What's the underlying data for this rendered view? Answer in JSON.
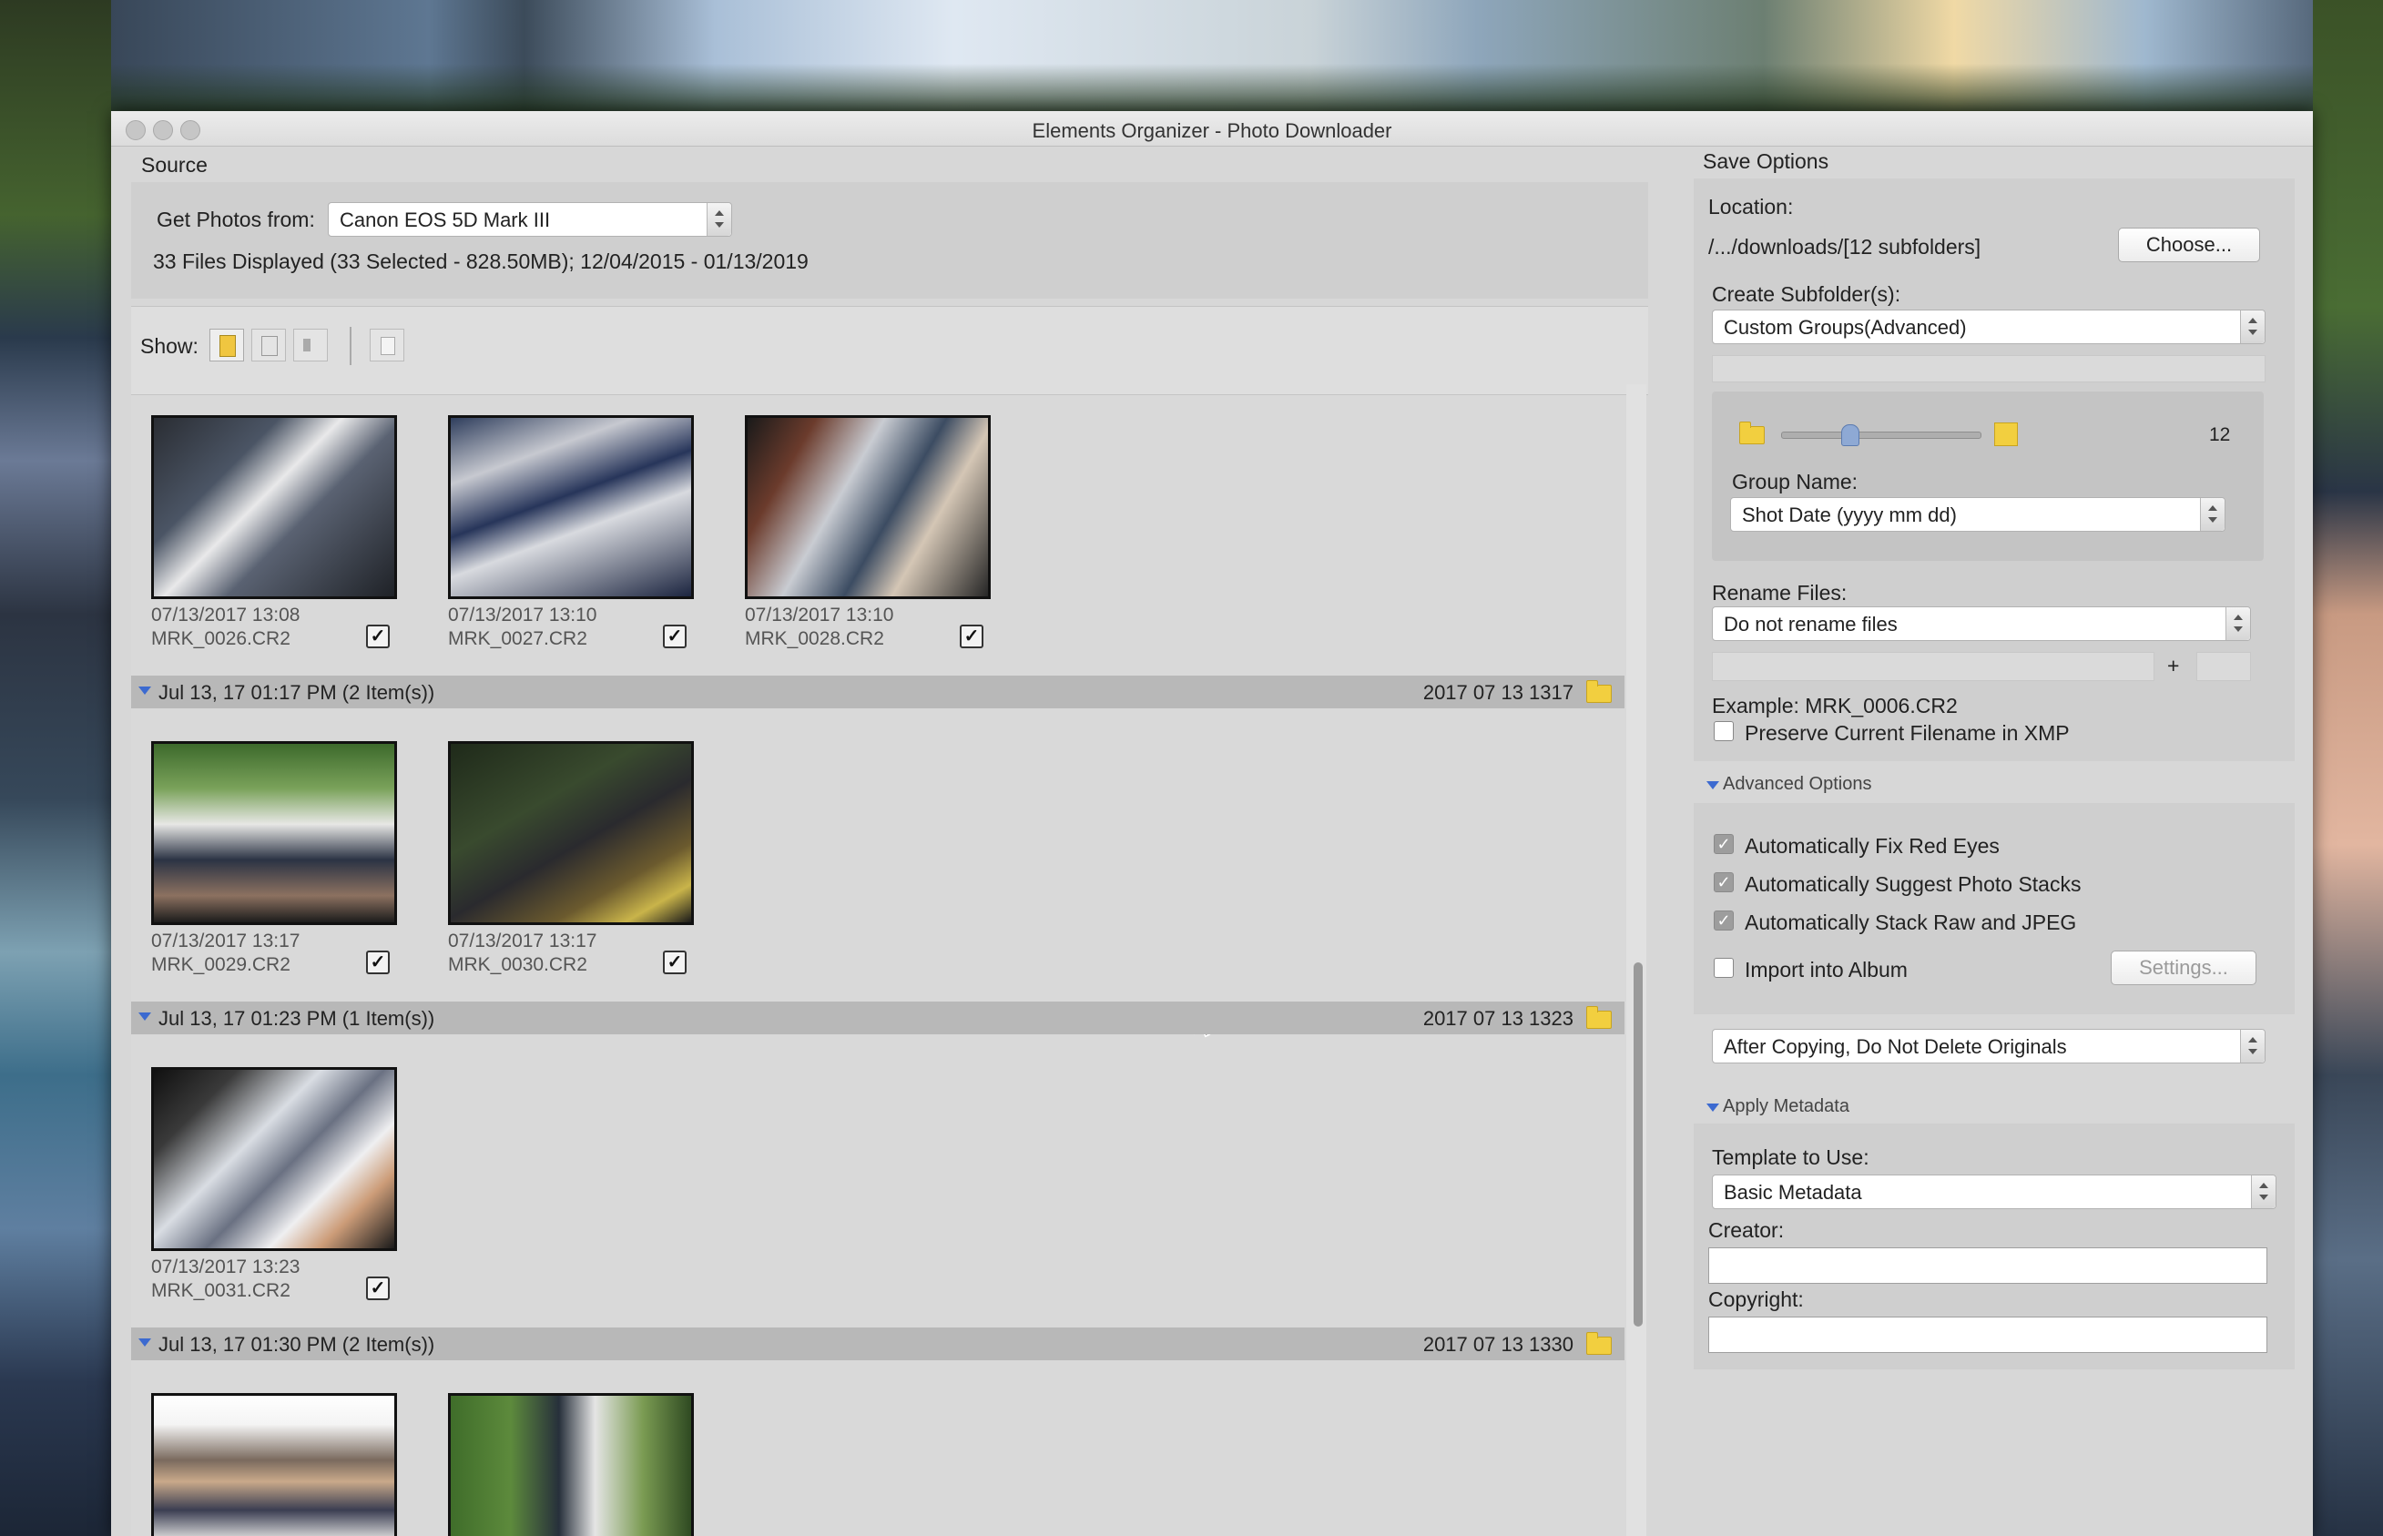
{
  "window": {
    "title": "Elements Organizer - Photo Downloader"
  },
  "source": {
    "section_title": "Source",
    "get_photos_label": "Get Photos from:",
    "device_value": "Canon EOS 5D Mark III",
    "files_summary": "33 Files Displayed (33 Selected - 828.50MB); 12/04/2015 - 01/13/2019"
  },
  "show": {
    "label": "Show:"
  },
  "groups": [
    {
      "label": "",
      "folder": "",
      "items": [
        {
          "date": "07/13/2017 13:08",
          "file": "MRK_0026.CR2",
          "checked": true
        },
        {
          "date": "07/13/2017 13:10",
          "file": "MRK_0027.CR2",
          "checked": true
        },
        {
          "date": "07/13/2017 13:10",
          "file": "MRK_0028.CR2",
          "checked": true
        }
      ]
    },
    {
      "label": "Jul 13, 17 01:17 PM (2 Item(s))",
      "folder": "2017 07 13 1317",
      "items": [
        {
          "date": "07/13/2017 13:17",
          "file": "MRK_0029.CR2",
          "checked": true
        },
        {
          "date": "07/13/2017 13:17",
          "file": "MRK_0030.CR2",
          "checked": true
        }
      ]
    },
    {
      "label": "Jul 13, 17 01:23 PM (1 Item(s))",
      "folder": "2017 07 13 1323",
      "items": [
        {
          "date": "07/13/2017 13:23",
          "file": "MRK_0031.CR2",
          "checked": true
        }
      ]
    },
    {
      "label": "Jul 13, 17 01:30 PM (2 Item(s))",
      "folder": "2017 07 13 1330",
      "items": []
    }
  ],
  "save_options": {
    "section_title": "Save Options",
    "location_label": "Location:",
    "location_value": "/.../downloads/[12 subfolders]",
    "choose_button": "Choose...",
    "create_subfolders_label": "Create Subfolder(s):",
    "create_subfolders_value": "Custom Groups(Advanced)",
    "slider_value": "12",
    "group_name_label": "Group Name:",
    "group_name_value": "Shot Date (yyyy mm dd)",
    "rename_files_label": "Rename Files:",
    "rename_files_value": "Do not rename files",
    "plus": "+",
    "example": "Example: MRK_0006.CR2",
    "preserve_label": "Preserve Current Filename in XMP"
  },
  "advanced_options": {
    "title": "Advanced Options",
    "fix_red_eyes": "Automatically Fix Red Eyes",
    "suggest_stacks": "Automatically Suggest Photo Stacks",
    "stack_raw_jpeg": "Automatically Stack Raw and JPEG",
    "import_album": "Import into Album",
    "settings_button": "Settings...",
    "after_copying": "After Copying, Do Not Delete Originals"
  },
  "apply_metadata": {
    "title": "Apply Metadata",
    "template_label": "Template to Use:",
    "template_value": "Basic Metadata",
    "creator_label": "Creator:",
    "copyright_label": "Copyright:"
  }
}
